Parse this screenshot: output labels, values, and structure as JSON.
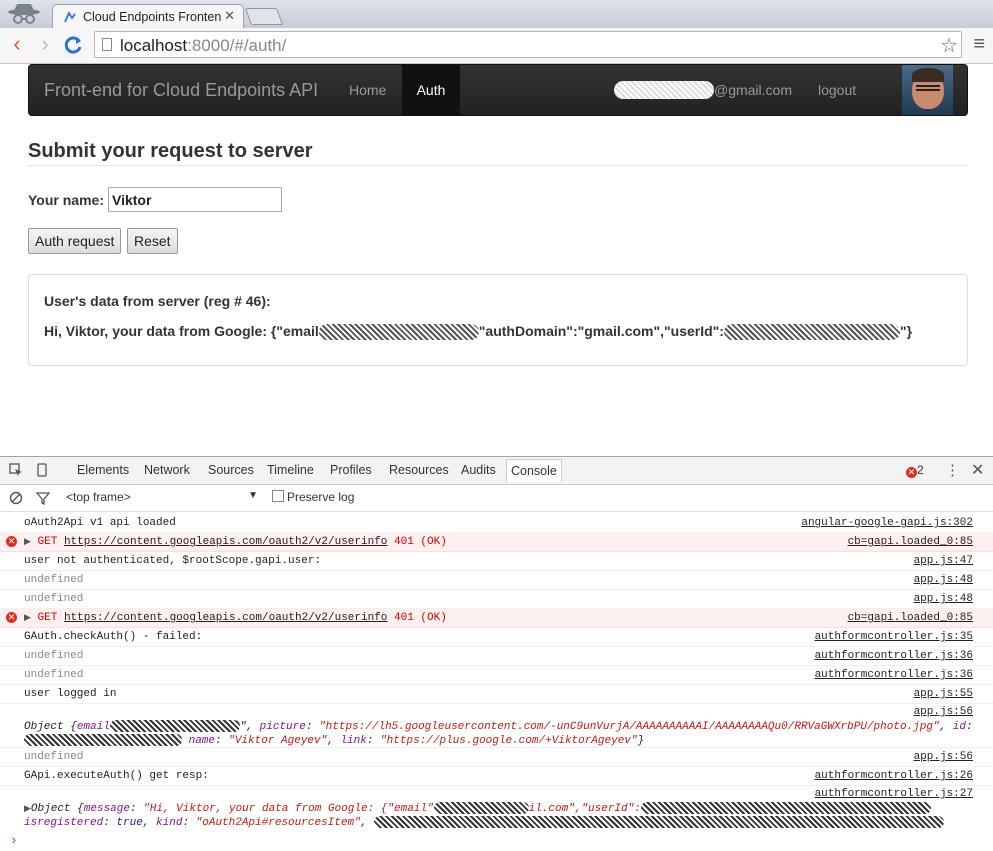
{
  "browser": {
    "tab_title": "Cloud Endpoints Fronten",
    "url_host": "localhost",
    "url_rest": ":8000/#/auth/"
  },
  "navbar": {
    "brand": "Front-end for Cloud Endpoints API",
    "home": "Home",
    "auth": "Auth",
    "email_suffix": "@gmail.com",
    "logout": "logout"
  },
  "form": {
    "heading": "Submit your request to server",
    "name_label": "Your name:",
    "name_value": "Viktor",
    "auth_button": "Auth request",
    "reset_button": "Reset"
  },
  "result": {
    "title": "User's data from server (reg # 46):",
    "line_start": "Hi, Viktor, your data from Google: {\"email",
    "line_mid": "\"authDomain\":\"gmail.com\",\"userId\":",
    "line_end": "\"}"
  },
  "devtools": {
    "tabs": [
      "Elements",
      "Network",
      "Sources",
      "Timeline",
      "Profiles",
      "Resources",
      "Audits",
      "Console"
    ],
    "error_count": "2",
    "frame": "<top frame>",
    "preserve_log": "Preserve log",
    "logs": [
      {
        "msg": "oAuth2Api v1 api loaded",
        "src": "angular-google-gapi.js:302"
      },
      {
        "get": "GET",
        "url": "https://content.googleapis.com/oauth2/v2/userinfo",
        "status": "401 (OK)",
        "src": "cb=gapi.loaded_0:85"
      },
      {
        "msg": "user not authenticated, $rootScope.gapi.user:",
        "src": "app.js:47"
      },
      {
        "msg": "undefined",
        "src": "app.js:48"
      },
      {
        "msg": "undefined",
        "src": "app.js:48"
      },
      {
        "get": "GET",
        "url": "https://content.googleapis.com/oauth2/v2/userinfo",
        "status": "401 (OK)",
        "src": "cb=gapi.loaded_0:85"
      },
      {
        "msg": "GAuth.checkAuth() - failed:",
        "src": "authformcontroller.js:35"
      },
      {
        "msg": "undefined",
        "src": "authformcontroller.js:36"
      },
      {
        "msg": "undefined",
        "src": "authformcontroller.js:36"
      },
      {
        "msg": "user logged in",
        "src": "app.js:55"
      },
      {
        "src": "app.js:56"
      },
      {
        "msg": "undefined",
        "src": "app.js:56"
      },
      {
        "msg": "GApi.executeAuth() get resp:",
        "src": "authformcontroller.js:26"
      },
      {
        "src": "authformcontroller.js:27"
      }
    ],
    "obj1": {
      "prefix": "Object {",
      "k_email": "email",
      "k_picture": "picture",
      "v_picture": "\"https://lh5.googleusercontent.com/-unC9unVurjA/AAAAAAAAAAI/AAAAAAAAQu0/RRVaGWXrbPU/photo.jpg\"",
      "k_id": "id",
      "k_name": "name",
      "v_name": "\"Viktor Ageyev\"",
      "k_link": "link",
      "v_link": "\"https://plus.google.com/+ViktorAgeyev\""
    },
    "obj2": {
      "prefix": "Object {",
      "k_message": "message",
      "v_message_start": "\"Hi, Viktor, your data from Google: {\"email\"",
      "v_message_mid": "il.com\",\"userId\":",
      "k_isreg": "isregistered",
      "v_isreg": "true",
      "k_kind": "kind",
      "v_kind": "\"oAuth2Api#resourcesItem\""
    }
  }
}
